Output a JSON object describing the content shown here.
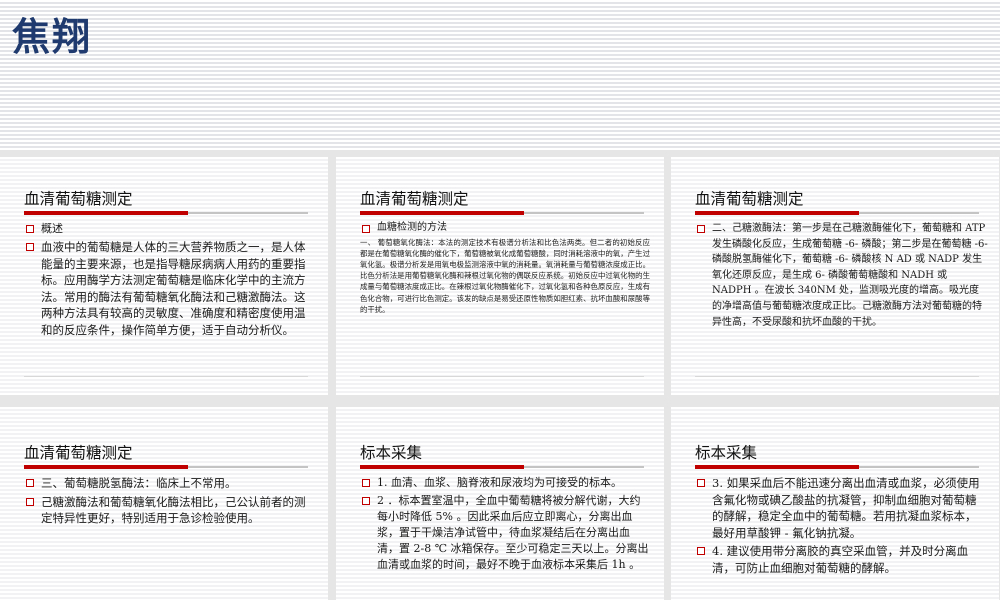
{
  "header": {
    "title": "焦翔"
  },
  "slides": [
    {
      "title": "血清葡萄糖测定",
      "bullets": [
        "概述",
        "血液中的葡萄糖是人体的三大营养物质之一，是人体能量的主要来源，也是指导糖尿病病人用药的重要指标。应用酶学方法测定葡萄糖是临床化学中的主流方法。常用的酶法有葡萄糖氧化酶法和己糖激酶法。这两种方法具有较高的灵敏度、准确度和精密度使用温和的反应条件，操作简单方便，适于自动分析仪。"
      ]
    },
    {
      "title": "血清葡萄糖测定",
      "bullets": [
        "血糖检测的方法"
      ],
      "paragraph": "一、 葡萄糖氧化酶法：本法的测定技术有极谱分析法和比色法两类。但二者的初始反应都是在葡萄糖氧化酶的催化下，葡萄糖被氧化成葡萄糖酸，同时消耗溶液中的氧，产生过氧化氢。极谱分析发是用氧电极监测溶液中氧的消耗量。氧消耗量与葡萄糖浓度成正比。比色分析法是用葡萄糖氧化酶和辣根过氧化物的偶联反应系统。初始反应中过氧化物的生成量与葡萄糖浓度成正比。在辣根过氧化物酶催化下，过氧化氢和各种色原反应，生成有色化合物，可进行比色测定。该发的缺点是易受还原性物质如胆红素、抗坏血酸和尿酸等的干扰。"
    },
    {
      "title": "血清葡萄糖测定",
      "bullets": [
        "二、己糖激酶法：第一步是在己糖激酶催化下，葡萄糖和 ATP 发生磷酸化反应，生成葡萄糖 -6- 磷酸；第二步是在葡萄糖 -6- 磷酸脱氢酶催化下，葡萄糖 -6- 磷酸核 N AD 或 NADP 发生氧化还原反应，是生成 6- 磷酸葡萄糖酸和 NADH 或 NADPH 。在波长 340NM 处，监测吸光度的增高。吸光度的净增高值与葡萄糖浓度成正比。己糖激酶方法对葡萄糖的特异性高，不受尿酸和抗坏血酸的干扰。"
      ]
    },
    {
      "title": "血清葡萄糖测定",
      "bullets": [
        "三、葡萄糖脱氢酶法：临床上不常用。",
        "  己糖激酶法和葡萄糖氧化酶法相比，己公认前者的测定特异性更好，特别适用于急诊检验使用。"
      ]
    },
    {
      "title": "标本采集",
      "bullets": [
        "1. 血清、血浆、脑脊液和尿液均为可接受的标本。",
        "2 ．标本置室温中，全血中葡萄糖将被分解代谢，大约每小时降低 5% 。因此采血后应立即离心，分离出血浆，置于干燥洁净试管中，待血浆凝结后在分离出血清，置 2-8 ℃ 冰箱保存。至少可稳定三天以上。分离出血清或血浆的时间，最好不晚于血液标本采集后 1h 。"
      ]
    },
    {
      "title": "标本采集",
      "bullets": [
        "3. 如果采血后不能迅速分离出血清或血浆，必须使用含氟化物或碘乙酸盐的抗凝管，抑制血细胞对葡萄糖的酵解，稳定全血中的葡萄糖。若用抗凝血浆标本，最好用草酸钾 - 氟化钠抗凝。",
        "4. 建议使用带分离胶的真空采血管，并及时分离血清，可防止血细胞对葡萄糖的酵解。"
      ]
    }
  ],
  "colors": {
    "accent": "#c00000",
    "title": "#1f3a6e"
  }
}
